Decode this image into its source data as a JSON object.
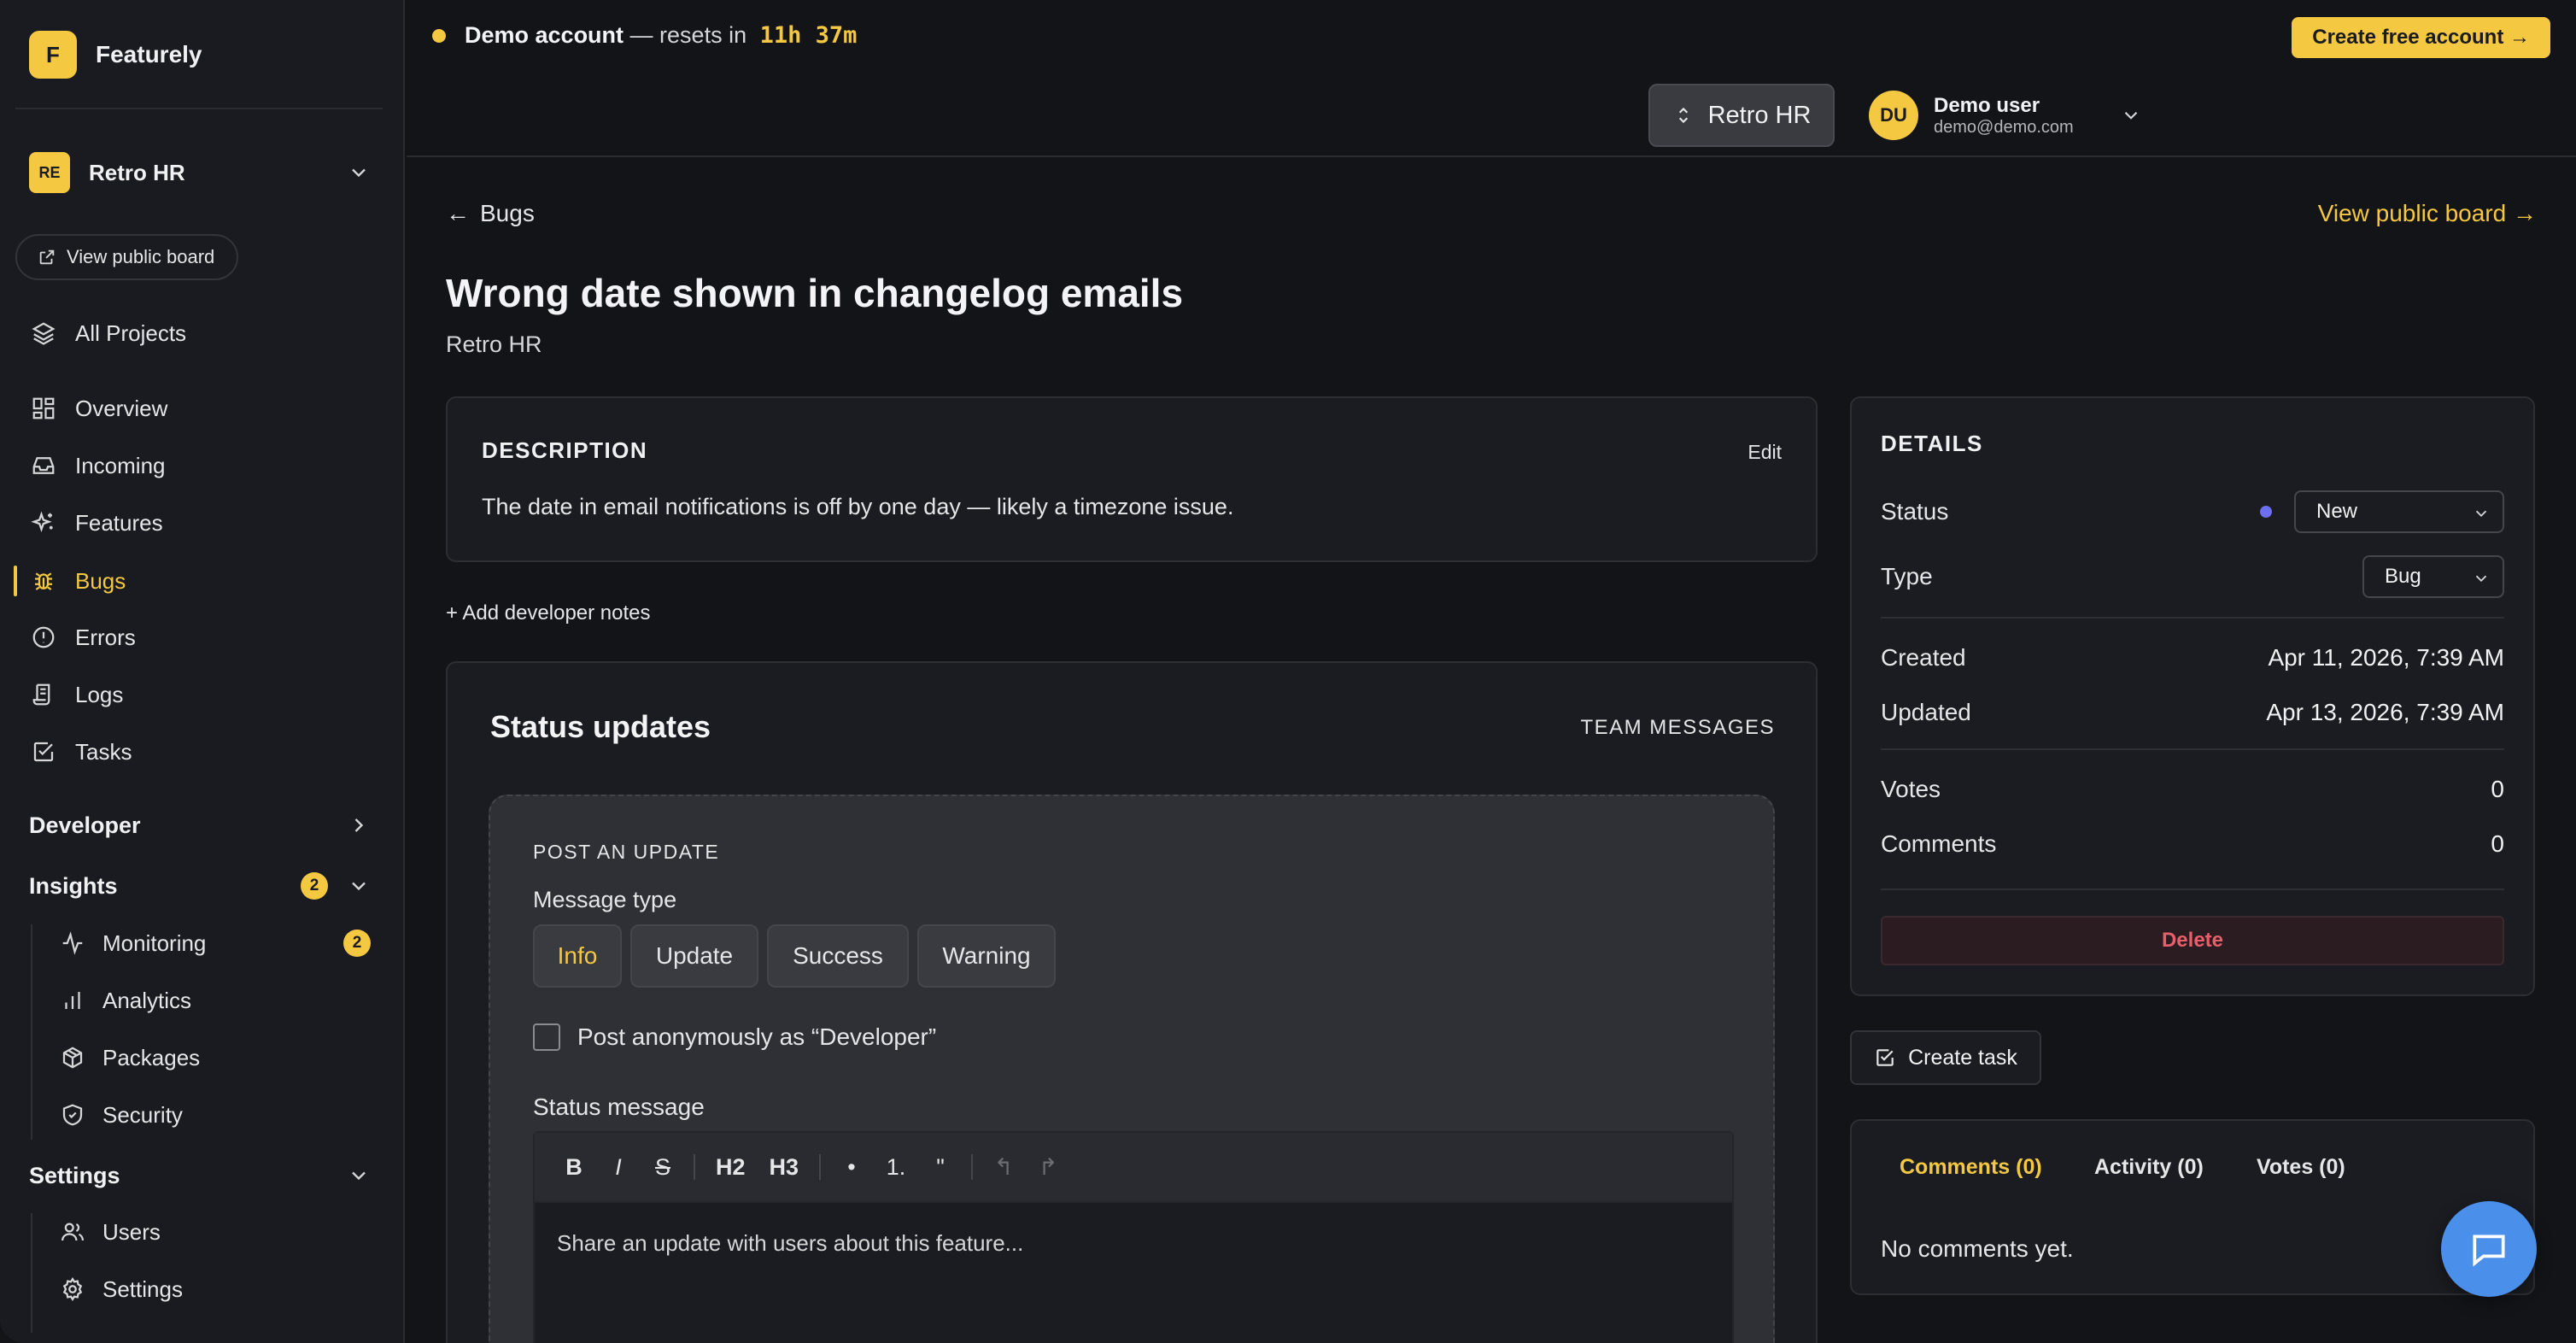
{
  "brand": {
    "initial": "F",
    "name": "Featurely"
  },
  "sidebar": {
    "project": {
      "badge": "RE",
      "name": "Retro HR"
    },
    "view_public_board": "View public board",
    "all_projects": "All Projects",
    "nav": [
      {
        "label": "Overview",
        "icon": "grid-icon"
      },
      {
        "label": "Incoming",
        "icon": "inbox-icon"
      },
      {
        "label": "Features",
        "icon": "sparkles-icon"
      },
      {
        "label": "Bugs",
        "icon": "bug-icon",
        "active": true
      },
      {
        "label": "Errors",
        "icon": "alert-circle-icon"
      },
      {
        "label": "Logs",
        "icon": "scroll-icon"
      },
      {
        "label": "Tasks",
        "icon": "check-square-icon"
      }
    ],
    "developer": "Developer",
    "insights": {
      "label": "Insights",
      "count": "2"
    },
    "insights_items": [
      {
        "label": "Monitoring",
        "icon": "activity-icon",
        "count": "2"
      },
      {
        "label": "Analytics",
        "icon": "bar-chart-icon"
      },
      {
        "label": "Packages",
        "icon": "package-icon"
      },
      {
        "label": "Security",
        "icon": "shield-icon"
      }
    ],
    "settings": "Settings",
    "settings_items": [
      {
        "label": "Users",
        "icon": "users-icon"
      },
      {
        "label": "Settings",
        "icon": "gear-icon"
      }
    ]
  },
  "topbar": {
    "demo_strong": "Demo account",
    "demo_rest": " — resets in ",
    "demo_time": "11h 37m",
    "cta": "Create free account →",
    "project_button": "Retro HR",
    "user": {
      "initials": "DU",
      "name": "Demo user",
      "email": "demo@demo.com"
    }
  },
  "main": {
    "back": "Bugs",
    "public_link": "View public board →",
    "title": "Wrong date shown in changelog emails",
    "subtitle": "Retro HR",
    "description": {
      "label": "DESCRIPTION",
      "edit": "Edit",
      "text": "The date in email notifications is off by one day — likely a timezone issue."
    },
    "add_notes": "+ Add developer notes",
    "status_updates": {
      "title": "Status updates",
      "team_messages": "TEAM MESSAGES",
      "post_label": "POST AN UPDATE",
      "message_type_label": "Message type",
      "message_types": [
        "Info",
        "Update",
        "Success",
        "Warning"
      ],
      "anonymous_label": "Post anonymously as “Developer”",
      "status_message_label": "Status message",
      "toolbar": [
        "B",
        "I",
        "S",
        "H2",
        "H3",
        "•",
        "1.",
        "\"",
        "↰",
        "↱"
      ],
      "placeholder": "Share an update with users about this feature..."
    }
  },
  "details": {
    "label": "DETAILS",
    "status_label": "Status",
    "status_value": "New",
    "status_color": "#6b6ff0",
    "type_label": "Type",
    "type_value": "Bug",
    "created_label": "Created",
    "created_value": "Apr 11, 2026, 7:39 AM",
    "updated_label": "Updated",
    "updated_value": "Apr 13, 2026, 7:39 AM",
    "votes_label": "Votes",
    "votes_value": "0",
    "comments_label": "Comments",
    "comments_value": "0",
    "delete": "Delete"
  },
  "create_task": "Create task",
  "comments": {
    "tabs": [
      "Comments (0)",
      "Activity (0)",
      "Votes (0)"
    ],
    "empty": "No comments yet."
  },
  "colors": {
    "accent": "#f5c842",
    "danger": "#e5606a",
    "fab": "#4a8fea"
  }
}
